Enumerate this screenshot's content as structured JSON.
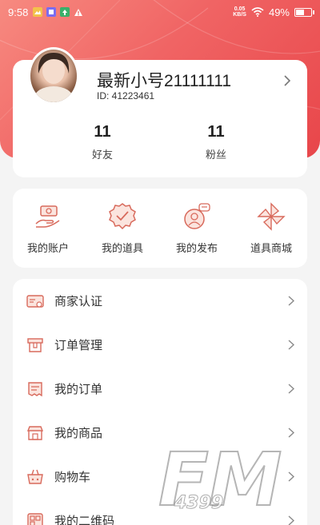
{
  "status_bar": {
    "time": "9:58",
    "net_speed_value": "0.05",
    "net_speed_unit": "KB/S",
    "battery": "49%",
    "battery_level": 0.49
  },
  "profile": {
    "username": "最新小号21111111",
    "user_id": "ID: 41223461",
    "stats": [
      {
        "value": "11",
        "label": "好友"
      },
      {
        "value": "11",
        "label": "粉丝"
      }
    ]
  },
  "tools": [
    {
      "label": "我的账户",
      "icon": "hand-money-icon"
    },
    {
      "label": "我的道具",
      "icon": "badge-check-icon"
    },
    {
      "label": "我的发布",
      "icon": "person-chat-icon"
    },
    {
      "label": "道具商城",
      "icon": "pinwheel-icon"
    }
  ],
  "menu": [
    {
      "label": "商家认证",
      "icon": "id-card-icon"
    },
    {
      "label": "订单管理",
      "icon": "order-box-icon"
    },
    {
      "label": "我的订单",
      "icon": "receipt-icon"
    },
    {
      "label": "我的商品",
      "icon": "shop-icon"
    },
    {
      "label": "购物车",
      "icon": "cart-icon"
    },
    {
      "label": "我的二维码",
      "icon": "qrcode-icon"
    }
  ],
  "watermark": {
    "text": "FM",
    "subtext": "4399"
  },
  "colors": {
    "accent": "#ef5a5a",
    "icon_stroke": "#d86a5c",
    "hero_start": "#f78a80",
    "hero_end": "#e8464a"
  }
}
